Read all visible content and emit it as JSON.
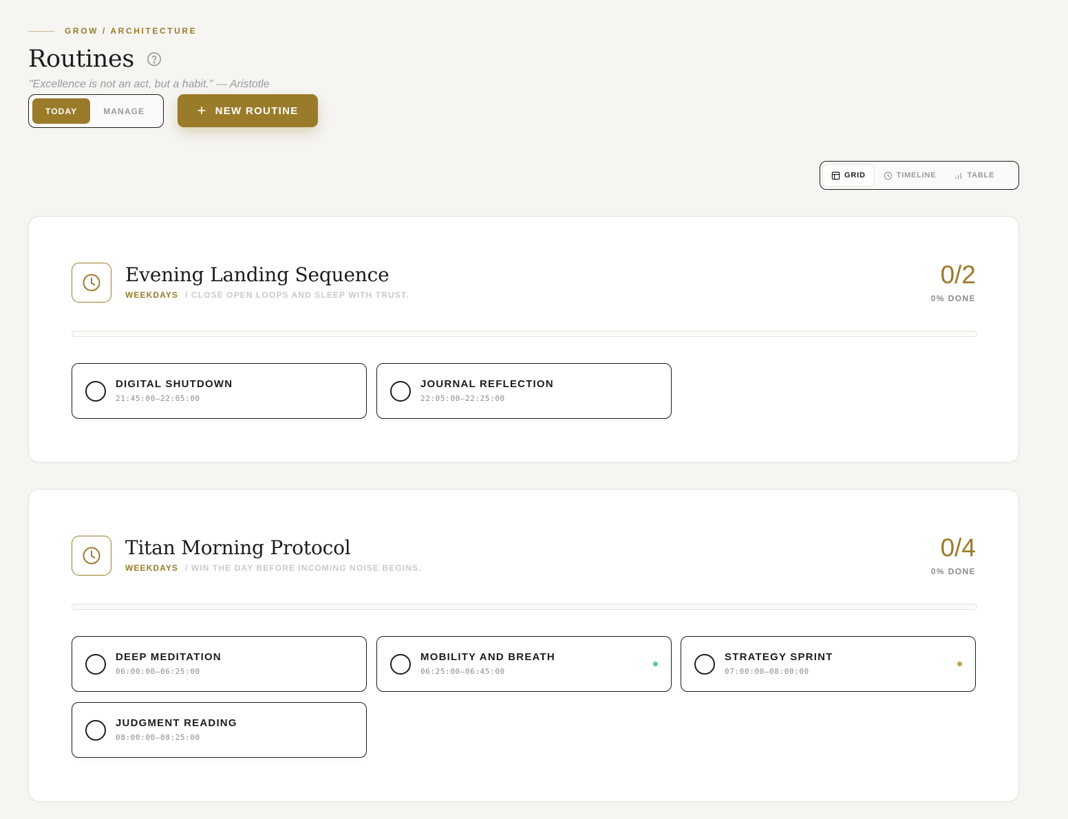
{
  "breadcrumb": "GROW / ARCHITECTURE",
  "page": {
    "title": "Routines",
    "quote": "\"Excellence is not an act, but a habit.\" — Aristotle"
  },
  "mode_toggle": {
    "today": "TODAY",
    "manage": "MANAGE",
    "selected": "TODAY"
  },
  "new_routine_label": "NEW ROUTINE",
  "view_switch": {
    "grid": "GRID",
    "timeline": "TIMELINE",
    "table": "TABLE",
    "selected": "GRID"
  },
  "colors": {
    "accent": "#9a7b2a",
    "background": "#f6f5f2",
    "green_dot": "#5fc98a",
    "gold_dot": "#c4a24a"
  },
  "routines": [
    {
      "name": "Evening Landing Sequence",
      "frequency": "WEEKDAYS",
      "description": "/ CLOSE OPEN LOOPS AND SLEEP WITH TRUST.",
      "count": "0/2",
      "percent": "0% DONE",
      "progress": 0,
      "tasks": [
        {
          "name": "DIGITAL SHUTDOWN",
          "time": "21:45:00–22:05:00",
          "indicator": null
        },
        {
          "name": "JOURNAL REFLECTION",
          "time": "22:05:00–22:25:00",
          "indicator": null
        }
      ]
    },
    {
      "name": "Titan Morning Protocol",
      "frequency": "WEEKDAYS",
      "description": "/ WIN THE DAY BEFORE INCOMING NOISE BEGINS.",
      "count": "0/4",
      "percent": "0% DONE",
      "progress": 0,
      "tasks": [
        {
          "name": "DEEP MEDITATION",
          "time": "06:00:00–06:25:00",
          "indicator": null
        },
        {
          "name": "MOBILITY AND BREATH",
          "time": "06:25:00–06:45:00",
          "indicator": "green"
        },
        {
          "name": "STRATEGY SPRINT",
          "time": "07:00:00–08:00:00",
          "indicator": "gold"
        },
        {
          "name": "JUDGMENT READING",
          "time": "08:00:00–08:25:00",
          "indicator": null
        }
      ]
    }
  ]
}
